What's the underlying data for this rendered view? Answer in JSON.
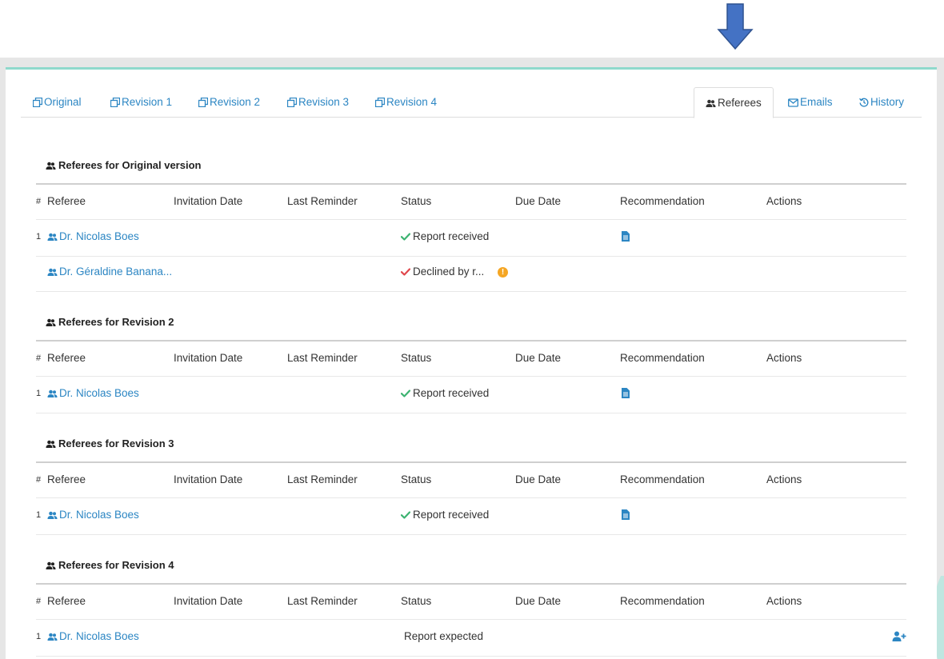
{
  "tabs": {
    "left": [
      {
        "label": "Original"
      },
      {
        "label": "Revision 1"
      },
      {
        "label": "Revision 2"
      },
      {
        "label": "Revision 3"
      },
      {
        "label": "Revision 4"
      }
    ],
    "right": [
      {
        "label": "Referees",
        "active": true
      },
      {
        "label": "Emails"
      },
      {
        "label": "History"
      }
    ]
  },
  "columns": [
    "#",
    "Referee",
    "Invitation Date",
    "Last Reminder",
    "Status",
    "Due Date",
    "Recommendation",
    "Actions"
  ],
  "sections": [
    {
      "title": "Referees for Original version",
      "rows": [
        {
          "num": "1",
          "referee": "Dr. Nicolas Boes",
          "status": "Report received",
          "status_icon": "check-green-icon",
          "recommendation_icon": "document-icon"
        },
        {
          "num": "",
          "referee": "Dr. Géraldine Banana...",
          "status": "Declined by r...",
          "status_icon": "check-red-icon",
          "warning": "!"
        }
      ]
    },
    {
      "title": "Referees for Revision 2",
      "rows": [
        {
          "num": "1",
          "referee": "Dr. Nicolas Boes",
          "status": "Report received",
          "status_icon": "check-green-icon",
          "recommendation_icon": "document-icon"
        }
      ]
    },
    {
      "title": "Referees for Revision 3",
      "rows": [
        {
          "num": "1",
          "referee": "Dr. Nicolas Boes",
          "status": "Report received",
          "status_icon": "check-green-icon",
          "recommendation_icon": "document-icon"
        }
      ]
    },
    {
      "title": "Referees for Revision 4",
      "rows": [
        {
          "num": "1",
          "referee": "Dr. Nicolas Boes",
          "status": "Report expected",
          "action_icon": "add-user-icon"
        }
      ]
    }
  ],
  "colors": {
    "link": "#2c86c3",
    "check_green": "#3cb371",
    "check_red": "#e0474c",
    "warning": "#f5a623",
    "accent_border": "#8fd9cc",
    "arrow": "#4472c4"
  }
}
